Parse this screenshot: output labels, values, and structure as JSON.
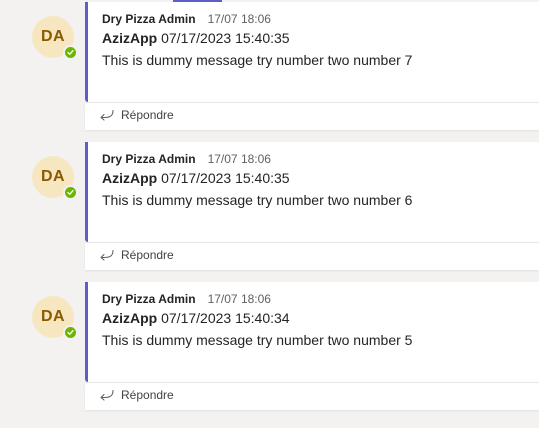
{
  "accent_color": "#5b5fc7",
  "presence_color": "#6bb700",
  "messages": [
    {
      "avatar_initials": "DA",
      "sender": "Dry Pizza Admin",
      "timestamp": "17/07 18:06",
      "app_name": "AzizApp",
      "app_datetime": "07/17/2023 15:40:35",
      "text": "This is dummy message try number two number 7",
      "reply_label": "Répondre",
      "reply_icon": "reply-arrow-icon",
      "presence_icon": "available-check-icon"
    },
    {
      "avatar_initials": "DA",
      "sender": "Dry Pizza Admin",
      "timestamp": "17/07 18:06",
      "app_name": "AzizApp",
      "app_datetime": "07/17/2023 15:40:35",
      "text": "This is dummy message try number two number 6",
      "reply_label": "Répondre",
      "reply_icon": "reply-arrow-icon",
      "presence_icon": "available-check-icon"
    },
    {
      "avatar_initials": "DA",
      "sender": "Dry Pizza Admin",
      "timestamp": "17/07 18:06",
      "app_name": "AzizApp",
      "app_datetime": "07/17/2023 15:40:34",
      "text": "This is dummy message try number two number 5",
      "reply_label": "Répondre",
      "reply_icon": "reply-arrow-icon",
      "presence_icon": "available-check-icon"
    }
  ]
}
